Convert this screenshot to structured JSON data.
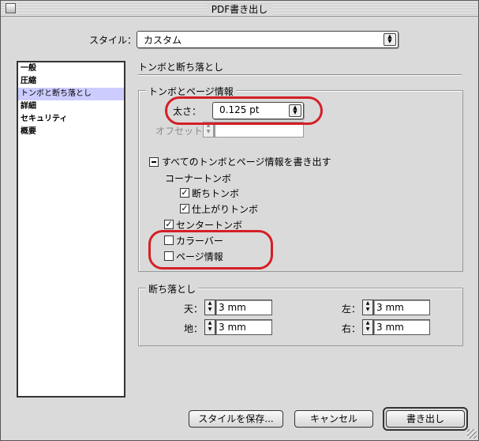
{
  "window": {
    "title": "PDF書き出し"
  },
  "style": {
    "label": "スタイル：",
    "value": "カスタム"
  },
  "sidebar": {
    "items": [
      {
        "label": "一般"
      },
      {
        "label": "圧縮"
      },
      {
        "label": "トンボと断ち落とし",
        "selected": true
      },
      {
        "label": "詳細"
      },
      {
        "label": "セキュリティ"
      },
      {
        "label": "概要"
      }
    ]
  },
  "panel": {
    "title": "トンボと断ち落とし"
  },
  "marks": {
    "group_title": "トンボとページ情報",
    "weight_label": "太さ：",
    "weight_value": "0.125 pt",
    "offset_label": "オフセット：",
    "offset_value": "",
    "all_marks_label": "すべてのトンボとページ情報を書き出す",
    "corner_label": "コーナートンボ",
    "crop_label": "断ちトンボ",
    "crop_checked": true,
    "trim_label": "仕上がりトンボ",
    "trim_checked": true,
    "center_label": "センタートンボ",
    "center_checked": true,
    "color_bar_label": "カラーバー",
    "color_bar_checked": false,
    "page_info_label": "ページ情報",
    "page_info_checked": false
  },
  "bleed": {
    "group_title": "断ち落とし",
    "top_label": "天：",
    "top_value": "3 mm",
    "bottom_label": "地：",
    "bottom_value": "3 mm",
    "left_label": "左：",
    "left_value": "3 mm",
    "right_label": "右：",
    "right_value": "3 mm"
  },
  "buttons": {
    "save_style": "スタイルを保存...",
    "cancel": "キャンセル",
    "export": "書き出し"
  },
  "colors": {
    "annotation": "#d41f26",
    "selection": "#ccccff"
  }
}
